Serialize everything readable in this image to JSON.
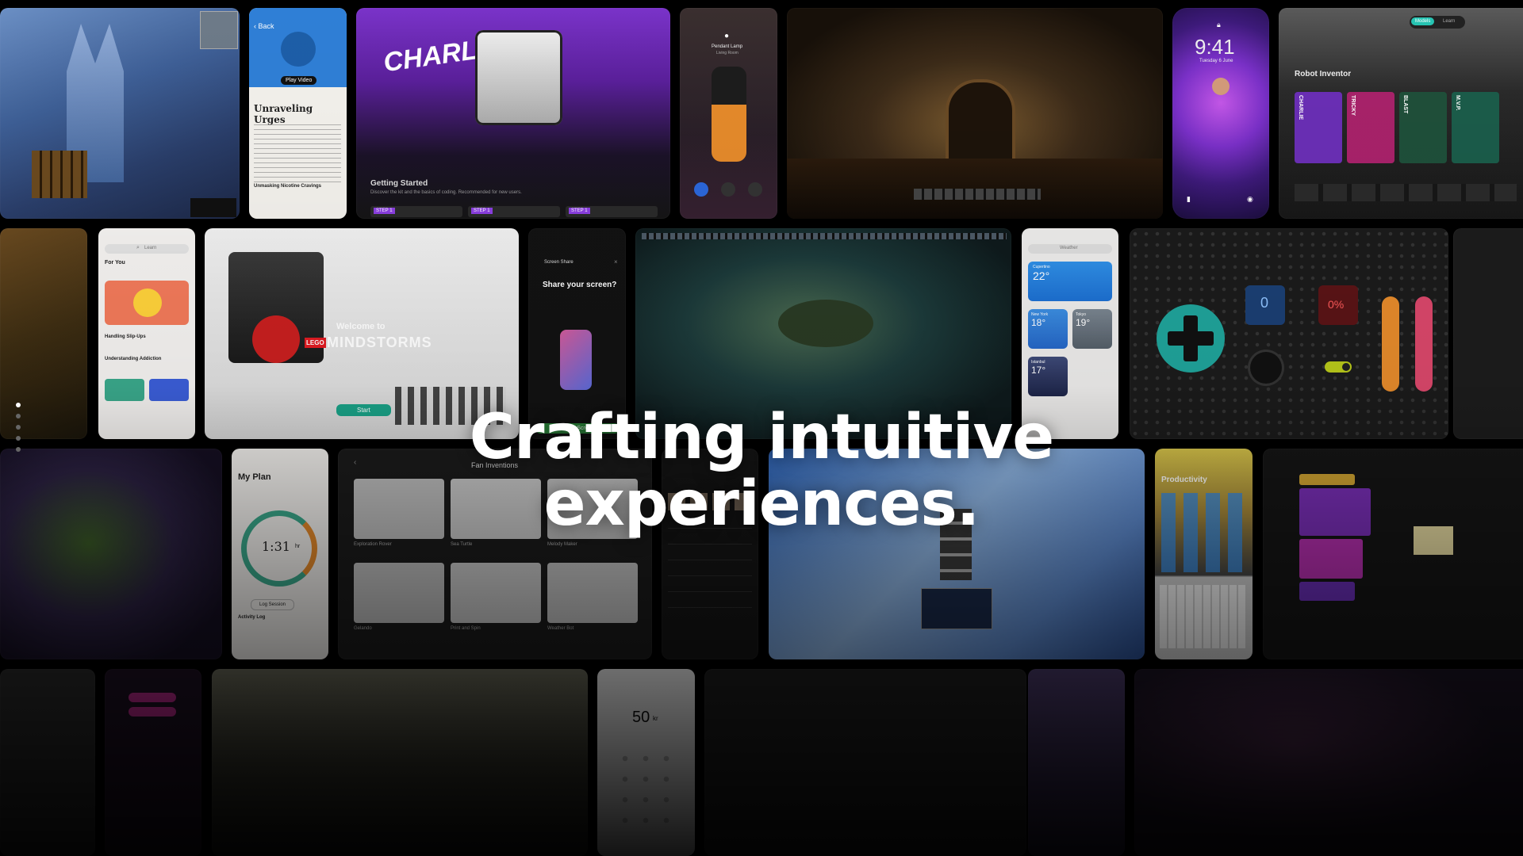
{
  "hero": {
    "line1": "Crafting intuitive",
    "line2": "experiences."
  },
  "tiles": {
    "urges": {
      "back": "‹ Back",
      "button": "Play Video",
      "title": "Unraveling Urges",
      "section": "Unmasking Nicotine Cravings"
    },
    "charlie": {
      "name": "CHARLIE",
      "heading": "Getting Started",
      "sub": "Discover the kit and the basics of coding. Recommended for new users.",
      "steps": [
        "STEP 1",
        "STEP 1",
        "STEP 1"
      ]
    },
    "lamp": {
      "title": "Pendant Lamp",
      "sub": "Living Room"
    },
    "lock": {
      "time": "9:41",
      "date": "Tuesday 6 June"
    },
    "robot_inventor": {
      "tabs": [
        "Models",
        "Learn"
      ],
      "title": "Robot Inventor",
      "cards": [
        "CHARLIE",
        "TRICKY",
        "BLAST",
        "M.V.P."
      ]
    },
    "foryou": {
      "search": "Learn",
      "title": "For You",
      "item1": "Handling Slip-Ups",
      "item2": "Understanding Addiction"
    },
    "mindstorms": {
      "welcome": "Welcome to",
      "brand": "LEGO",
      "name": "MINDSTORMS",
      "start": "Start"
    },
    "share": {
      "header": "Screen Share",
      "question": "Share your screen?",
      "button": "Share Screen"
    },
    "weather": {
      "search": "Weather",
      "cities": [
        {
          "name": "Cupertino",
          "temp": "22°"
        },
        {
          "name": "New York",
          "temp": "18°"
        },
        {
          "name": "Tokyo",
          "temp": "19°"
        },
        {
          "name": "Istanbul",
          "temp": "17°"
        }
      ]
    },
    "controller": {
      "counter": "0",
      "percent": "0%"
    },
    "myplan": {
      "title": "My Plan",
      "time": "1:31",
      "unit": "hr",
      "log": "Log Session",
      "activity": "Activity Log"
    },
    "fan": {
      "title": "Fan Inventions",
      "items": [
        "Exploration Rover",
        "Sea Turtle",
        "Melody Maker",
        "Gelando",
        "Print and Spin",
        "Weather Bot"
      ]
    },
    "productivity": {
      "title": "Productivity"
    },
    "price": {
      "amount": "50",
      "unit": "kr"
    }
  },
  "pager": {
    "count": 5,
    "active": 0
  },
  "colors": {
    "accent_purple": "#7b3fd0",
    "lamp_orange": "#e58a2b",
    "controller_teal": "#1fa39a",
    "mint": "#26c4b3"
  }
}
